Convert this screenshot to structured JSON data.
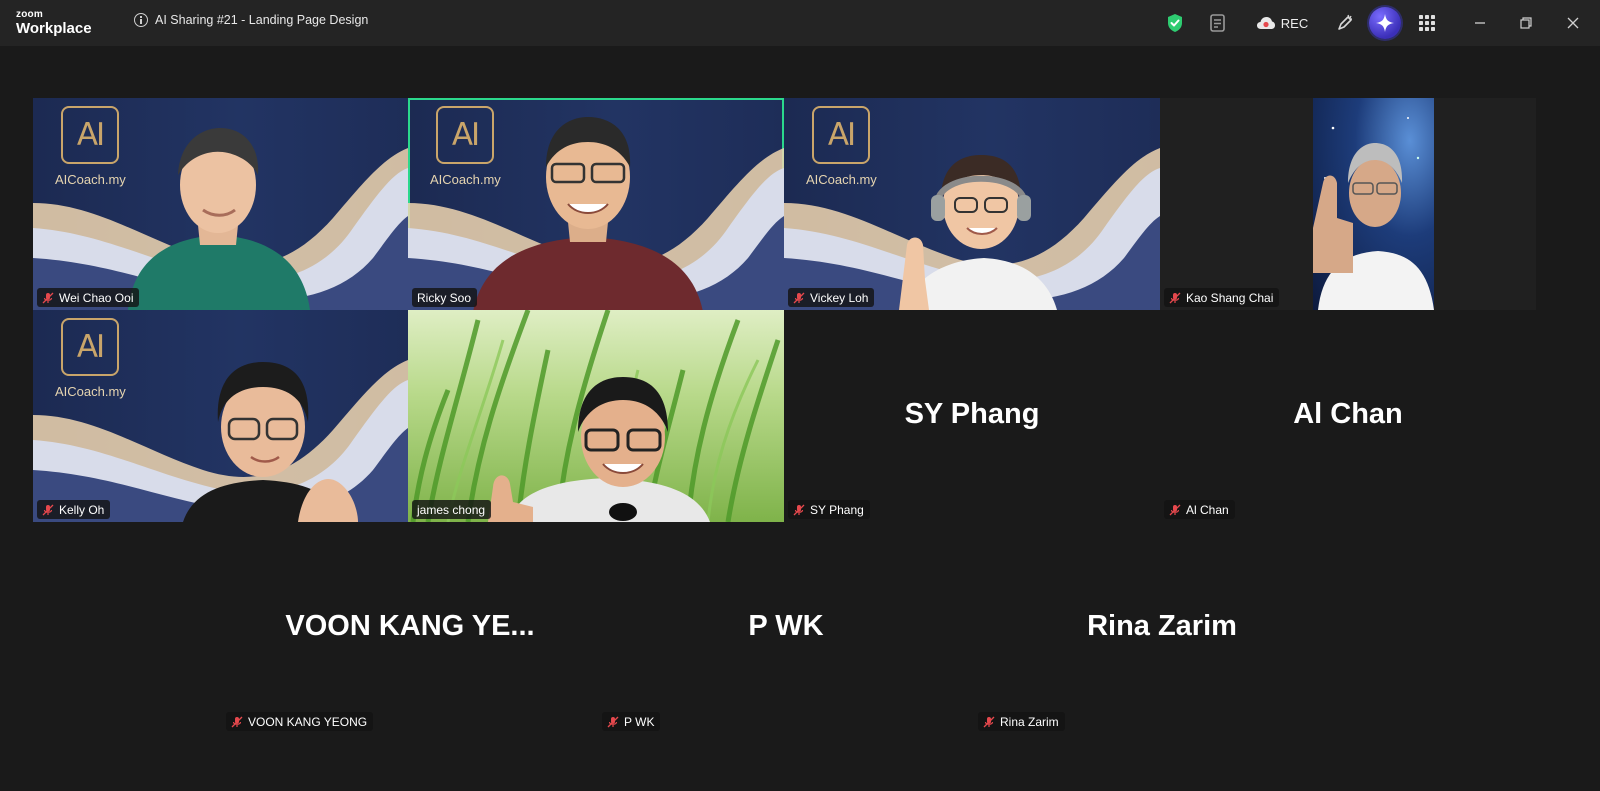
{
  "app": {
    "logo_line1": "zoom",
    "logo_line2": "Workplace",
    "meeting_title": "AI Sharing #21 - Landing Page Design",
    "rec_label": "REC"
  },
  "colors": {
    "accent_active_speaker": "#2bd88c",
    "shield_green": "#2ecc71",
    "mic_muted_red": "#e5484d",
    "titlebar_bg": "#242424",
    "gallery_bg": "#1a1a1a"
  },
  "virtual_background": {
    "logo_mark": "AI",
    "brand_text": "AICoach.my"
  },
  "participants": [
    {
      "name": "Wei Chao Ooi",
      "video": true,
      "background": "aicoach",
      "muted": true,
      "speaking": false
    },
    {
      "name": "Ricky Soo",
      "video": true,
      "background": "aicoach",
      "muted": false,
      "speaking": true
    },
    {
      "name": "Vickey Loh",
      "video": true,
      "background": "aicoach",
      "muted": true,
      "speaking": false
    },
    {
      "name": "Kao Shang Chai",
      "video": true,
      "background": "space",
      "muted": true,
      "speaking": false
    },
    {
      "name": "Kelly Oh",
      "video": true,
      "background": "aicoach",
      "muted": true,
      "speaking": false
    },
    {
      "name": "james chong",
      "video": true,
      "background": "grass",
      "muted": false,
      "speaking": false
    },
    {
      "name": "SY Phang",
      "display_name": "SY Phang",
      "video": false,
      "muted": true,
      "speaking": false
    },
    {
      "name": "Al Chan",
      "display_name": "Al Chan",
      "video": false,
      "muted": true,
      "speaking": false
    },
    {
      "name": "VOON KANG YEONG",
      "display_name": "VOON KANG YE...",
      "video": false,
      "muted": true,
      "speaking": false
    },
    {
      "name": "P WK",
      "display_name": "P WK",
      "video": false,
      "muted": true,
      "speaking": false
    },
    {
      "name": "Rina Zarim",
      "display_name": "Rina Zarim",
      "video": false,
      "muted": true,
      "speaking": false
    }
  ]
}
